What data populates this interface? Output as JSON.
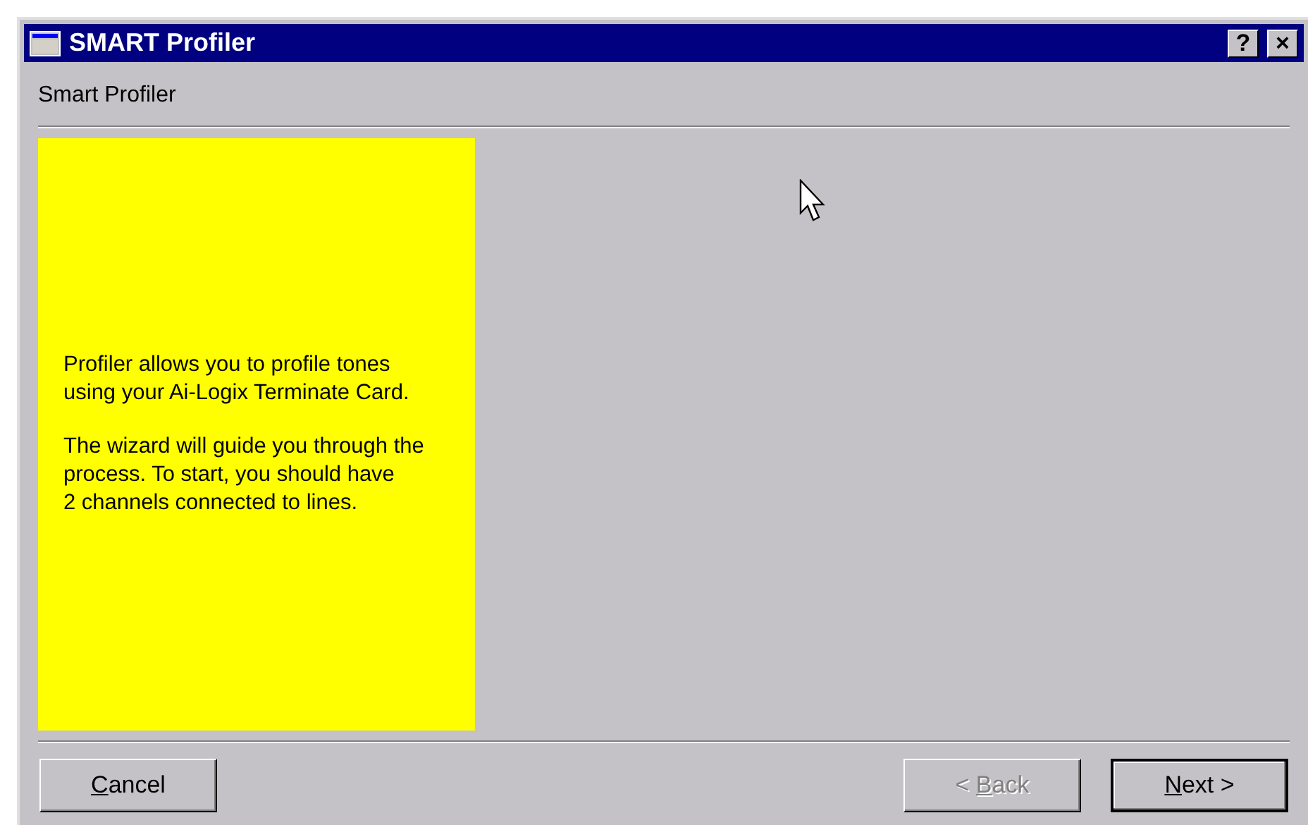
{
  "window": {
    "title": "SMART Profiler"
  },
  "title_buttons": [
    {
      "label": "?"
    },
    {
      "label": "×"
    }
  ],
  "header": {
    "title": "Smart Profiler"
  },
  "info_panel": {
    "paragraphs": [
      {
        "lines": [
          "Profiler allows you to profile tones",
          "using your Ai-Logix Terminate Card."
        ]
      },
      {
        "lines": [
          "The wizard will guide you through the",
          "process. To start, you should have",
          "2 channels connected to lines."
        ]
      }
    ]
  },
  "buttons": [
    {
      "key": "C",
      "after": "ancel",
      "disabled": false,
      "default": false
    },
    {
      "before": "< ",
      "key": "B",
      "after": "ack",
      "disabled": true,
      "default": false
    },
    {
      "key": "N",
      "after": "ext >",
      "disabled": false,
      "default": true
    }
  ]
}
